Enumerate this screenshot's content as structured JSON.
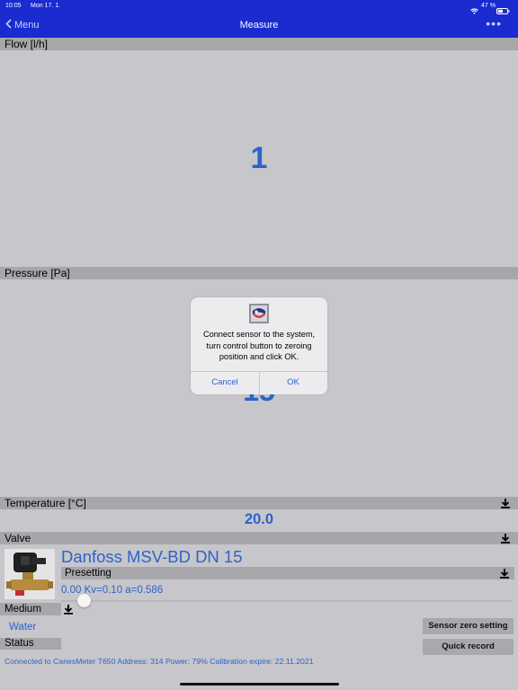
{
  "status_bar": {
    "time": "10:05",
    "date": "Mon 17. 1.",
    "battery": "47 %"
  },
  "nav": {
    "back_label": "Menu",
    "title": "Measure",
    "more": "•••"
  },
  "flow": {
    "label": "Flow [l/h]",
    "value": "1"
  },
  "pressure": {
    "label": "Pressure [Pa]",
    "value": "15"
  },
  "dialog": {
    "message": "Connect sensor to the system, turn control button to zeroing position and click OK.",
    "cancel_label": "Cancel",
    "ok_label": "OK"
  },
  "temperature": {
    "label": "Temperature [°C]",
    "value": "20.0"
  },
  "valve": {
    "label": "Valve",
    "name": "Danfoss MSV-BD DN 15",
    "presetting_label": "Presetting",
    "kv_text": "0.00 Kv=0.10 a=0.586",
    "presetting_level": 0.0
  },
  "medium": {
    "label": "Medium",
    "value": "Water"
  },
  "status": {
    "label": "Status"
  },
  "buttons": {
    "sensor_zero": "Sensor zero setting",
    "quick_record": "Quick record"
  },
  "connection_text": "Connected to CanesMeter T650 Address: 314 Power: 79% Calibration expire: 22.11.2021",
  "colors": {
    "nav_bg": "#1a2bd0",
    "value_blue": "#2d63c9",
    "bar_gray": "#a7a7ab",
    "bg": "#c6c6cb"
  }
}
